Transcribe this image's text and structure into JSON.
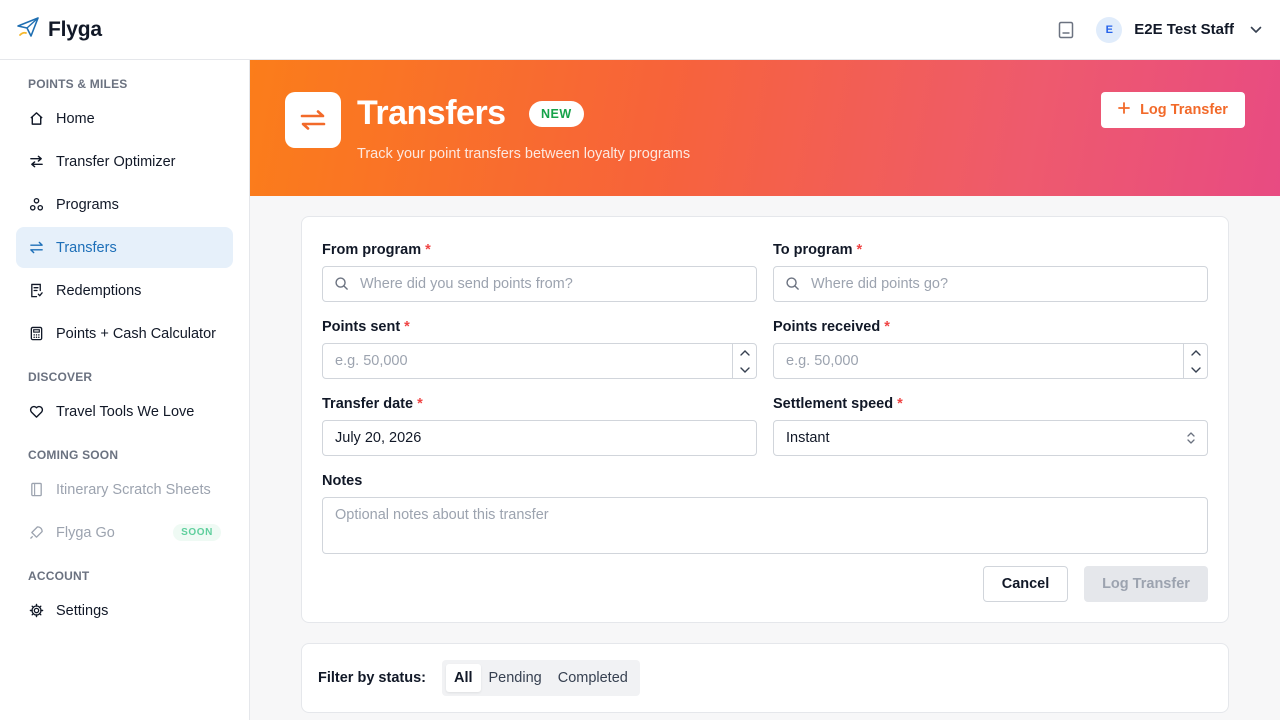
{
  "app": {
    "name": "Flyga"
  },
  "header": {
    "user_initial": "E",
    "user_name": "E2E Test Staff"
  },
  "sidebar": {
    "sections": [
      {
        "title": "POINTS & MILES"
      },
      {
        "title": "DISCOVER"
      },
      {
        "title": "COMING SOON"
      },
      {
        "title": "ACCOUNT"
      }
    ],
    "items": [
      {
        "label": "Home",
        "icon": "home-icon"
      },
      {
        "label": "Transfer Optimizer",
        "icon": "arrows-left-right-icon"
      },
      {
        "label": "Programs",
        "icon": "programs-icon"
      },
      {
        "label": "Transfers",
        "icon": "transfer-icon",
        "active": true
      },
      {
        "label": "Redemptions",
        "icon": "receipt-icon"
      },
      {
        "label": "Points + Cash Calculator",
        "icon": "calculator-icon"
      },
      {
        "label": "Travel Tools We Love",
        "icon": "heart-icon"
      },
      {
        "label": "Itinerary Scratch Sheets",
        "icon": "notebook-icon"
      },
      {
        "label": "Flyga Go",
        "icon": "rocket-icon",
        "badge": "SOON"
      },
      {
        "label": "Settings",
        "icon": "gear-icon"
      }
    ]
  },
  "hero": {
    "title": "Transfers",
    "badge": "NEW",
    "subtitle": "Track your point transfers between loyalty programs",
    "action_label": "Log Transfer"
  },
  "form": {
    "from_label": "From program",
    "from_placeholder": "Where did you send points from?",
    "to_label": "To program",
    "to_placeholder": "Where did points go?",
    "sent_label": "Points sent",
    "sent_placeholder": "e.g. 50,000",
    "received_label": "Points received",
    "received_placeholder": "e.g. 50,000",
    "date_label": "Transfer date",
    "date_value": "July 20, 2026",
    "speed_label": "Settlement speed",
    "speed_value": "Instant",
    "notes_label": "Notes",
    "notes_placeholder": "Optional notes about this transfer",
    "required_mark": "*",
    "cancel_label": "Cancel",
    "submit_label": "Log Transfer"
  },
  "filter": {
    "label": "Filter by status:",
    "options": [
      "All",
      "Pending",
      "Completed"
    ],
    "selected": "All"
  },
  "colors": {
    "accent": "#f26a2a",
    "active_nav_bg": "#e6f0fa",
    "active_nav_text": "#1d6fb8",
    "required": "#ef4444",
    "new_badge": "#16a34a"
  }
}
